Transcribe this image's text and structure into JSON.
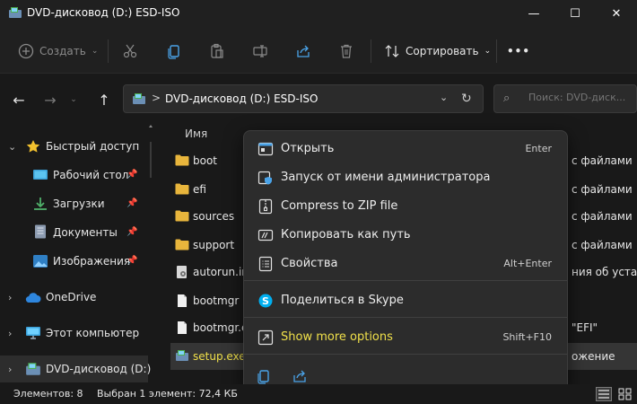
{
  "window": {
    "title": "DVD-дисковод (D:) ESD-ISO",
    "controls": {
      "minimize": "—",
      "maximize": "☐",
      "close": "✕"
    }
  },
  "toolbar": {
    "new_label": "Создать",
    "sort_label": "Сортировать",
    "more_label": "•••"
  },
  "navigation": {
    "back": "←",
    "forward": "→",
    "up": "↑"
  },
  "address": {
    "separator": ">",
    "path": "DVD-дисковод (D:) ESD-ISO"
  },
  "search": {
    "placeholder": "Поиск: DVD-диск..."
  },
  "sidebar": {
    "items": [
      {
        "label": "Быстрый доступ",
        "icon": "star-icon"
      },
      {
        "label": "Рабочий стол",
        "icon": "desktop-icon",
        "pinned": true
      },
      {
        "label": "Загрузки",
        "icon": "download-icon",
        "pinned": true
      },
      {
        "label": "Документы",
        "icon": "document-icon",
        "pinned": true
      },
      {
        "label": "Изображения",
        "icon": "pictures-icon",
        "pinned": true
      },
      {
        "label": "OneDrive",
        "icon": "cloud-icon"
      },
      {
        "label": "Этот компьютер",
        "icon": "computer-icon"
      },
      {
        "label": "DVD-дисковод (D:)",
        "icon": "dvd-drive-icon"
      }
    ]
  },
  "file_list": {
    "column_name": "Имя",
    "files": [
      {
        "name": "boot",
        "kind": "folder",
        "type": "с файлами"
      },
      {
        "name": "efi",
        "kind": "folder",
        "type": "с файлами"
      },
      {
        "name": "sources",
        "kind": "folder",
        "type": "с файлами"
      },
      {
        "name": "support",
        "kind": "folder",
        "type": "с файлами"
      },
      {
        "name": "autorun.in",
        "kind": "setup-file",
        "type": "ния об уста"
      },
      {
        "name": "bootmgr",
        "kind": "file",
        "type": ""
      },
      {
        "name": "bootmgr.e",
        "kind": "file",
        "type": "\"EFI\""
      },
      {
        "name": "setup.exe",
        "kind": "setup-exe",
        "type": "ожение"
      }
    ]
  },
  "context_menu": {
    "items": [
      {
        "label": "Открыть",
        "shortcut": "Enter"
      },
      {
        "label": "Запуск от имени администратора",
        "shortcut": ""
      },
      {
        "label": "Compress to ZIP file",
        "shortcut": ""
      },
      {
        "label": "Копировать как путь",
        "shortcut": ""
      },
      {
        "label": "Свойства",
        "shortcut": "Alt+Enter"
      },
      {
        "label": "Поделиться в Skype",
        "shortcut": ""
      },
      {
        "label": "Show more options",
        "shortcut": "Shift+F10"
      }
    ]
  },
  "status": {
    "items_count": "Элементов: 8",
    "selection": "Выбран 1 элемент: 72,4 КБ"
  },
  "colors": {
    "folder": "#e8b53c",
    "accent_blue": "#4aa3e8",
    "highlight_text": "#f0e04a",
    "background": "#191919",
    "menu_background": "#2c2c2c"
  }
}
